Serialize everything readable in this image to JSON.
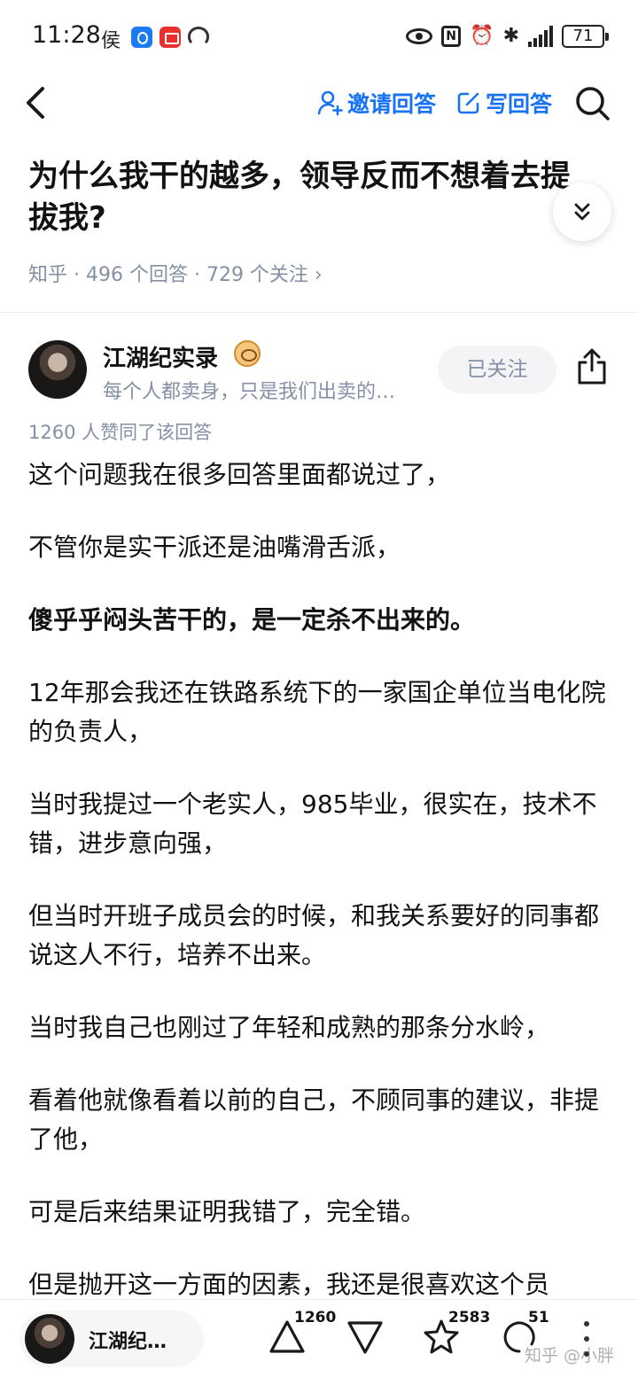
{
  "status_bar": {
    "time": "11:28",
    "carrier_glyph": "侯",
    "battery": "71"
  },
  "nav": {
    "invite_label": "邀请回答",
    "write_label": "写回答"
  },
  "question": {
    "title": "为什么我干的越多，领导反而不想着去提拔我?",
    "meta": "知乎 · 496 个回答 · 729 个关注 ›"
  },
  "author": {
    "name": "江湖纪实录",
    "bio": "每个人都卖身，只是我们出卖的…",
    "follow_label": "已关注"
  },
  "answer": {
    "vote_text": "1260 人赞同了该回答",
    "paragraphs": [
      "这个问题我在很多回答里面都说过了，",
      "不管你是实干派还是油嘴滑舌派，",
      "傻乎乎闷头苦干的，是一定杀不出来的。",
      "12年那会我还在铁路系统下的一家国企单位当电化院的负责人，",
      "当时我提过一个老实人，985毕业，很实在，技术不错，进步意向强，",
      "但当时开班子成员会的时候，和我关系要好的同事都说这人不行，培养不出来。",
      "当时我自己也刚过了年轻和成熟的那条分水岭，",
      "看着他就像看着以前的自己，不顾同事的建议，非提了他，",
      "可是后来结果证明我错了，完全错。",
      "但是抛开这一方面的因素，我还是很喜欢这个员"
    ]
  },
  "bottom_bar": {
    "mini_name": "江湖纪…",
    "upvote_count": "1260",
    "favorite_count": "2583",
    "comment_count": "51",
    "watermark": "知乎 @小胖"
  },
  "colors": {
    "accent": "#1772f6",
    "meta": "#8590a6"
  }
}
